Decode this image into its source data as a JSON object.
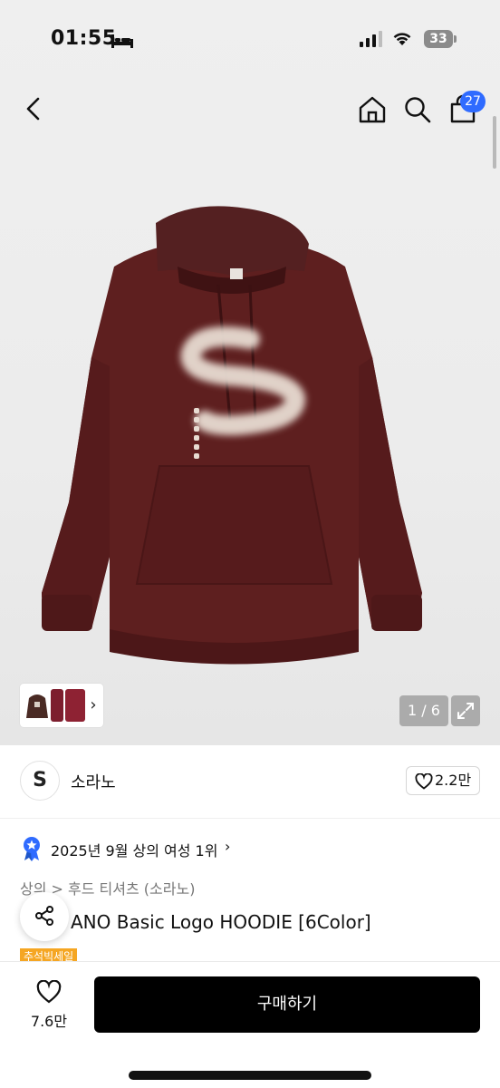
{
  "status_bar": {
    "time": "01:55",
    "battery": "33"
  },
  "nav": {
    "cart_count": "27"
  },
  "gallery": {
    "pager": "1 / 6",
    "thumb_arrow": "›"
  },
  "brand": {
    "logo_letter": "S",
    "name": "소라노",
    "likes": "2.2만"
  },
  "ranking": {
    "text": "2025년 9월 상의 여성 1위",
    "arrow": "›"
  },
  "breadcrumb": {
    "level1": "상의",
    "sep": " > ",
    "level2": "후드 티셔츠 (소라노)"
  },
  "product": {
    "title_partial": "ANO Basic Logo HOODIE [6Color]",
    "badge": "추석빅세일"
  },
  "bottom_bar": {
    "wish_count": "7.6만",
    "buy_label": "구매하기"
  },
  "colors": {
    "accent_badge": "#2f6bff",
    "buy_button": "#000000",
    "hoodie": "#5e1f1f",
    "sale_badge": "#f5a623"
  }
}
